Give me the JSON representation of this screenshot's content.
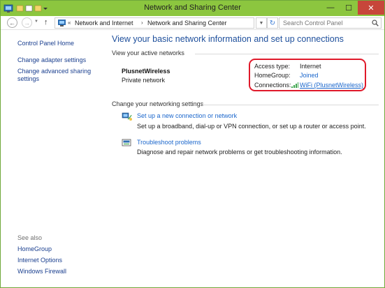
{
  "window": {
    "title": "Network and Sharing Center",
    "minimize_glyph": "—",
    "maximize_glyph": "☐",
    "close_glyph": "✕"
  },
  "nav": {
    "back_glyph": "←",
    "forward_glyph": "→",
    "history_glyph": "▼",
    "up_glyph": "↑",
    "breadcrumb_separator": "«",
    "breadcrumb": [
      "Network and Internet",
      "Network and Sharing Center"
    ],
    "crumb_arrow": "›",
    "dropdown_glyph": "▼",
    "refresh_glyph": "↻"
  },
  "search": {
    "placeholder": "Search Control Panel"
  },
  "sidebar": {
    "home": "Control Panel Home",
    "links": [
      "Change adapter settings",
      "Change advanced sharing",
      "settings"
    ],
    "see_also_label": "See also",
    "see_also": [
      "HomeGroup",
      "Internet Options",
      "Windows Firewall"
    ]
  },
  "main": {
    "title": "View your basic network information and set up connections",
    "active_networks_heading": "View your active networks",
    "network": {
      "name": "PlusnetWireless",
      "category": "Private network",
      "access_type_label": "Access type:",
      "access_type_value": "Internet",
      "homegroup_label": "HomeGroup:",
      "homegroup_value": "Joined",
      "connections_label": "Connections:",
      "connections_value": "WiFi (PlusnetWireless)"
    },
    "settings_heading": "Change your networking settings",
    "tasks": [
      {
        "title": "Set up a new connection or network",
        "description": "Set up a broadband, dial-up or VPN connection, or set up a router or access point."
      },
      {
        "title": "Troubleshoot problems",
        "description": "Diagnose and repair network problems or get troubleshooting information."
      }
    ]
  },
  "colors": {
    "titlebar": "#8cc63f",
    "link": "#1a66cc",
    "heading": "#1e4f9c",
    "highlight": "#e0192a",
    "close_button": "#c7463a"
  }
}
